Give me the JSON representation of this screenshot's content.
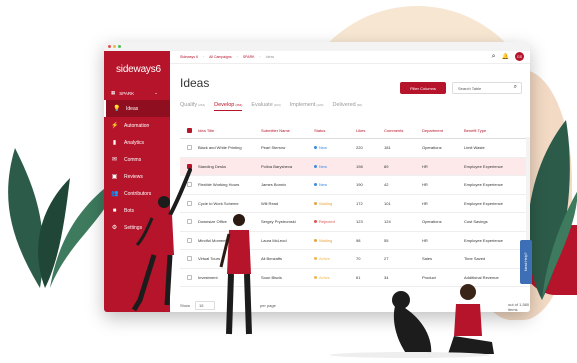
{
  "app": {
    "logo": "sideways6",
    "space": "SPARK",
    "breadcrumb": [
      "Sideways 6",
      "All Campaigns",
      "SPARK",
      "Ideas"
    ],
    "avatar": "GS",
    "colors": {
      "brand": "#b5142a",
      "active_nav": "#8f0e20",
      "status_new": "#3d8be0",
      "status_waiting": "#e8a33d",
      "status_rejected": "#e25454",
      "status_active": "#f0b84b"
    }
  },
  "sidebar": {
    "items": [
      {
        "label": "Ideas",
        "icon": "lightbulb-icon",
        "active": true
      },
      {
        "label": "Automation",
        "icon": "automation-icon"
      },
      {
        "label": "Analytics",
        "icon": "bar-chart-icon"
      },
      {
        "label": "Comms",
        "icon": "chat-icon"
      },
      {
        "label": "Reviews",
        "icon": "reviews-icon"
      },
      {
        "label": "Contributors",
        "icon": "people-icon"
      },
      {
        "label": "Bots",
        "icon": "bot-icon"
      },
      {
        "label": "Settings",
        "icon": "gear-icon"
      }
    ]
  },
  "main": {
    "title": "Ideas",
    "filter_button": "Filter Columns",
    "search_placeholder": "Search Table",
    "tabs": [
      {
        "label": "Qualify",
        "count": "(264)"
      },
      {
        "label": "Develop",
        "count": "(254)"
      },
      {
        "label": "Evaluate",
        "count": "(103)"
      },
      {
        "label": "Implement",
        "count": "(129)"
      },
      {
        "label": "Delivered",
        "count": "(66)"
      }
    ]
  },
  "table": {
    "columns": [
      "Idea Title",
      "Submitter Name",
      "Status",
      "Likes",
      "Comments",
      "Department",
      "Benefit Type"
    ],
    "rows": [
      {
        "title": "Black and White Printing",
        "submitter": "Pearl Sterrow",
        "status": "New",
        "status_color": "#3d8be0",
        "likes": "220",
        "comments": "181",
        "department": "Operations",
        "benefit": "Limit Waste"
      },
      {
        "title": "Standing Desks",
        "submitter": "Polina Barysheva",
        "status": "New",
        "status_color": "#3d8be0",
        "likes": "198",
        "comments": "89",
        "department": "HR",
        "benefit": "Employee Experience",
        "selected": true
      },
      {
        "title": "Flexible Working Hours",
        "submitter": "James Bonnix",
        "status": "New",
        "status_color": "#3d8be0",
        "likes": "190",
        "comments": "42",
        "department": "HR",
        "benefit": "Employee Experience"
      },
      {
        "title": "Cycle to Work Scheme",
        "submitter": "Will Read",
        "status": "Waiting",
        "status_color": "#e8a33d",
        "likes": "172",
        "comments": "101",
        "department": "HR",
        "benefit": "Employee Experience"
      },
      {
        "title": "Downsize Office",
        "submitter": "Sergey Prystromski",
        "status": "Rejected",
        "status_color": "#e25454",
        "likes": "123",
        "comments": "124",
        "department": "Operations",
        "benefit": "Cost Savings"
      },
      {
        "title": "Mindful Moments",
        "submitter": "Laura McLeod",
        "status": "Waiting",
        "status_color": "#e8a33d",
        "likes": "98",
        "comments": "55",
        "department": "HR",
        "benefit": "Employee Experience"
      },
      {
        "title": "Virtual Tours",
        "submitter": "Ali Benzaffs",
        "status": "Active",
        "status_color": "#f0b84b",
        "likes": "70",
        "comments": "27",
        "department": "Sales",
        "benefit": "Time Saved"
      },
      {
        "title": "Investment",
        "submitter": "Soon Biscis",
        "status": "Active",
        "status_color": "#f0b84b",
        "likes": "61",
        "comments": "34",
        "department": "Product",
        "benefit": "Additional Revenue"
      }
    ]
  },
  "footer": {
    "show_label": "Show",
    "page_size": "15",
    "per_page_label": "per page",
    "total": "out of 1,580 items"
  },
  "need_help": "Need Help?"
}
